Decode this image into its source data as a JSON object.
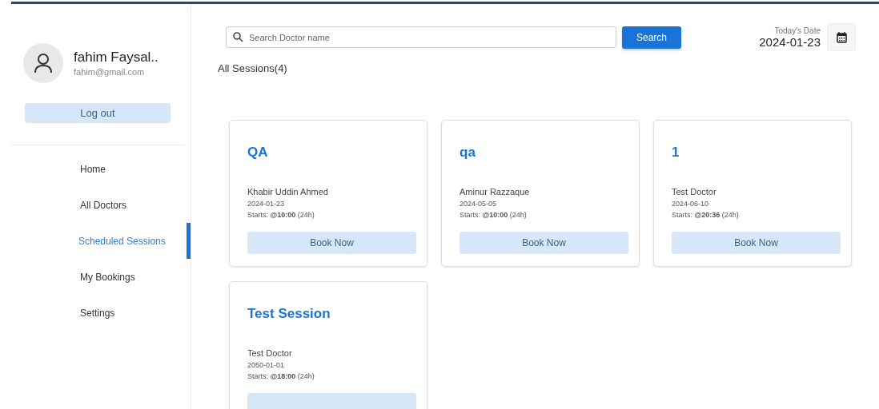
{
  "user": {
    "name": "fahim Faysal..",
    "email": "fahim@gmail.com"
  },
  "logout_button": "Log out",
  "nav": [
    {
      "label": "Home",
      "selected": false
    },
    {
      "label": "All Doctors",
      "selected": false
    },
    {
      "label": "Scheduled Sessions",
      "selected": true
    },
    {
      "label": "My Bookings",
      "selected": false
    },
    {
      "label": "Settings",
      "selected": false
    }
  ],
  "search": {
    "placeholder": "Search Doctor name",
    "button": "Search"
  },
  "date": {
    "label": "Today's Date",
    "value": "2024-01-23"
  },
  "heading": "All Sessions(4)",
  "sessions": [
    {
      "title": "QA",
      "doctor": "Khabir Uddin Ahmed",
      "date": "2024-01-23",
      "starts": "Starts: **@10:00** (24h)",
      "button": "Book Now"
    },
    {
      "title": "qa",
      "doctor": "Aminur Razzaque",
      "date": "2024-05-05",
      "starts": "Starts: **@10:00** (24h)",
      "button": "Book Now"
    },
    {
      "title": "1",
      "doctor": "Test Doctor",
      "date": "2024-06-10",
      "starts": "Starts: **@20:36** (24h)",
      "button": "Book Now"
    },
    {
      "title": "Test Session",
      "doctor": "Test Doctor",
      "date": "2050-01-01",
      "starts": "Starts: **@18:00** (24h)"
    }
  ]
}
